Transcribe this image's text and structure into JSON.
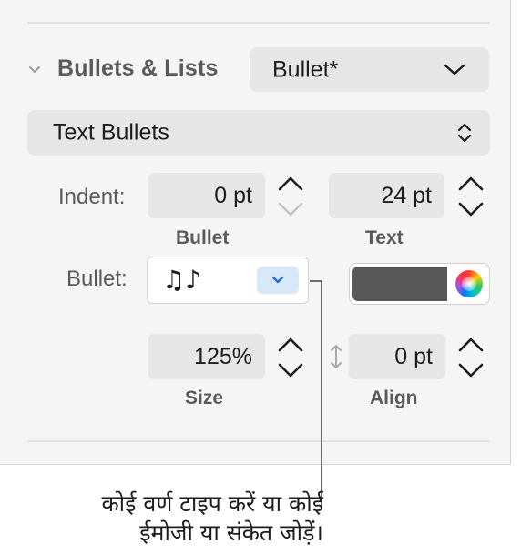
{
  "section": {
    "title": "Bullets & Lists"
  },
  "style_popup": {
    "value": "Bullet*"
  },
  "type_popup": {
    "value": "Text Bullets"
  },
  "indent": {
    "label": "Indent:",
    "bullet_value": "0 pt",
    "bullet_caption": "Bullet",
    "text_value": "24 pt",
    "text_caption": "Text"
  },
  "bullet": {
    "label": "Bullet:",
    "character": "♫♪"
  },
  "size": {
    "value": "125%",
    "caption": "Size"
  },
  "align": {
    "value": "0 pt",
    "caption": "Align"
  },
  "colors": {
    "swatch": "#585858",
    "panel": "#f5f5f5",
    "accent": "#1f6fd1"
  },
  "callout": {
    "line1": "कोई वर्ण टाइप करें या कोई",
    "line2": "ईमोजी या संकेत जोड़ें।"
  }
}
